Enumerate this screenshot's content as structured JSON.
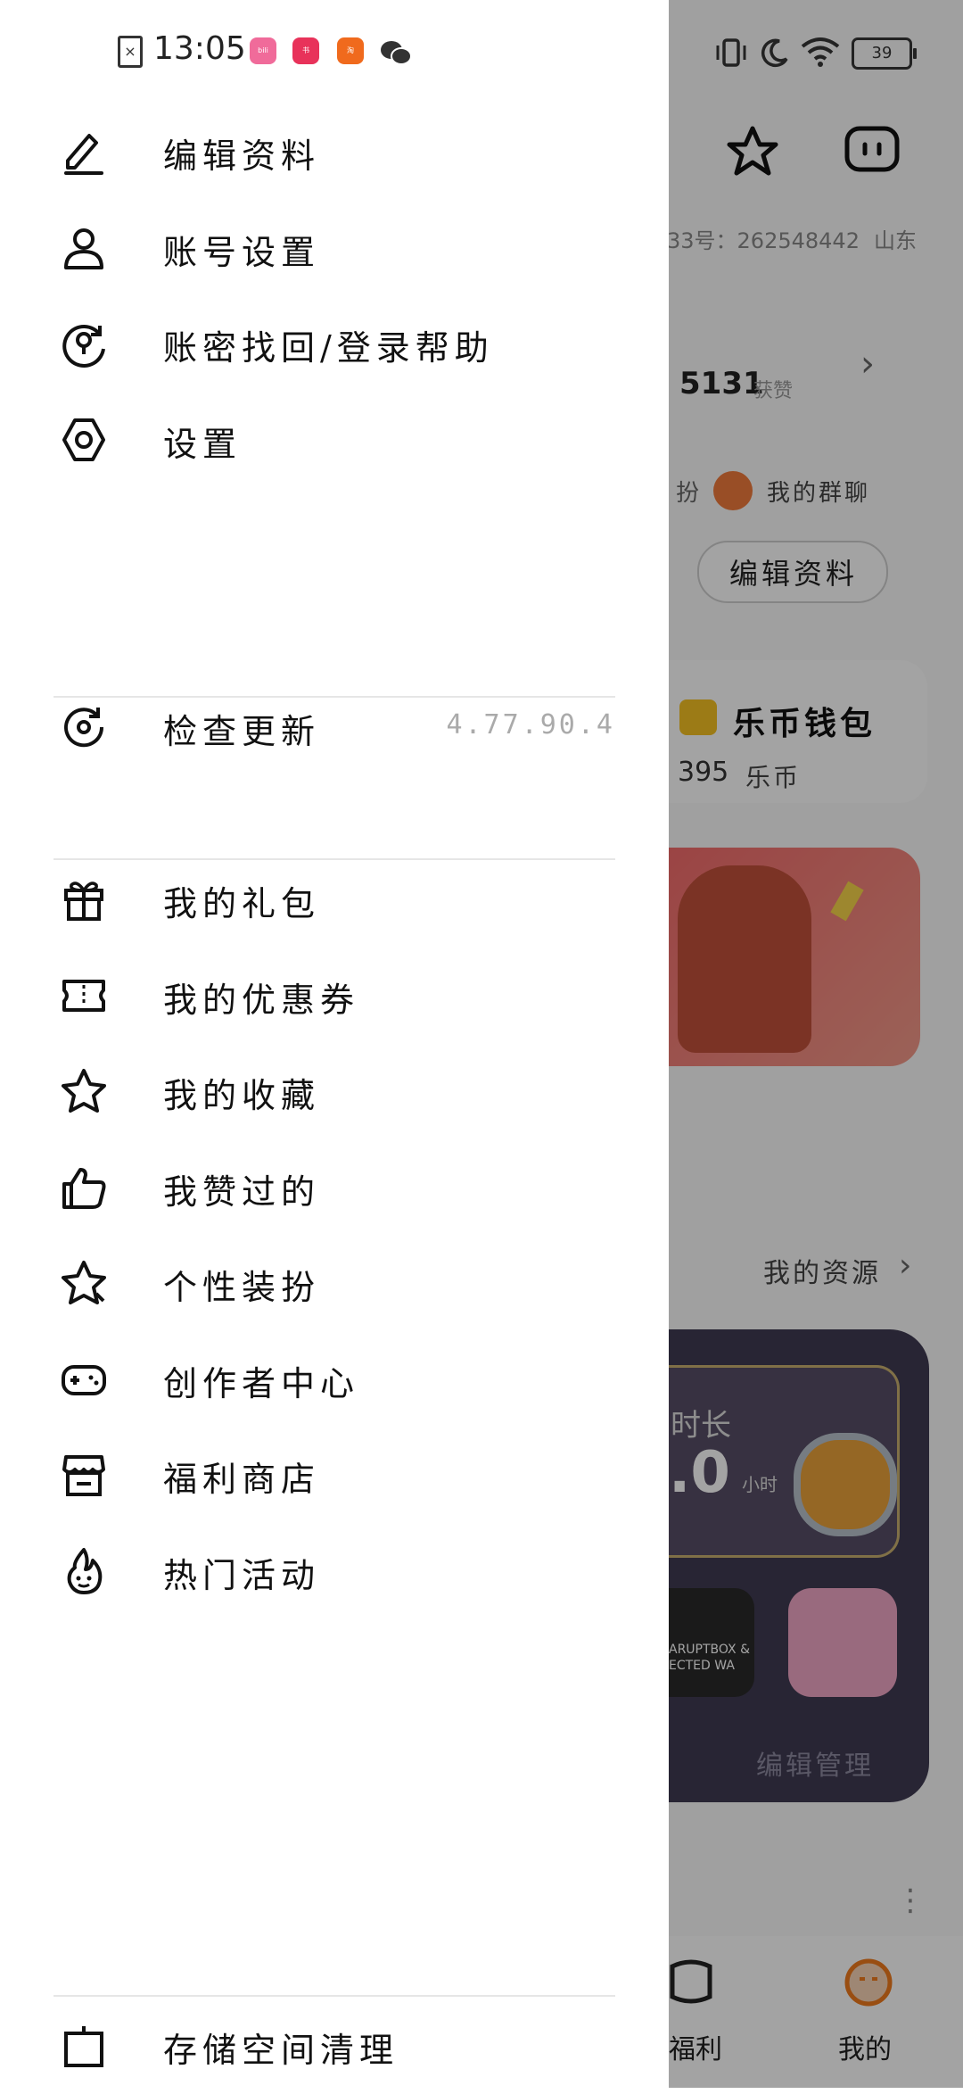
{
  "status_bar": {
    "time": "13:05",
    "battery": "39",
    "app_icons": [
      {
        "name": "bilibili-app-icon",
        "color": "#f06b9a"
      },
      {
        "name": "xiaohongshu-app-icon",
        "color": "#e8325a"
      },
      {
        "name": "taobao-app-icon",
        "color": "#f06a1d"
      },
      {
        "name": "wechat-app-icon",
        "color": "#333333"
      }
    ]
  },
  "drawer": {
    "items": [
      {
        "label": "编辑资料",
        "icon": "edit-icon"
      },
      {
        "label": "账号设置",
        "icon": "user-icon"
      },
      {
        "label": "账密找回/登录帮助",
        "icon": "account-recovery-icon"
      },
      {
        "label": "设置",
        "icon": "settings-hexagon-icon"
      },
      {
        "label": "检查更新",
        "icon": "update-check-icon",
        "meta": "4.77.90.4"
      },
      {
        "label": "我的礼包",
        "icon": "gift-icon"
      },
      {
        "label": "我的优惠券",
        "icon": "coupon-icon"
      },
      {
        "label": "我的收藏",
        "icon": "star-icon"
      },
      {
        "label": "我赞过的",
        "icon": "thumbs-up-icon"
      },
      {
        "label": "个性装扮",
        "icon": "sparkle-star-icon"
      },
      {
        "label": "创作者中心",
        "icon": "gamepad-icon"
      },
      {
        "label": "福利商店",
        "icon": "store-icon"
      },
      {
        "label": "热门活动",
        "icon": "hot-activity-icon"
      },
      {
        "label": "存储空间清理",
        "icon": "storage-clean-icon"
      }
    ]
  },
  "background_page": {
    "id_text": "33号：262548442",
    "location": "山东",
    "likes_value": "5131",
    "likes_label": "获赞",
    "fans_label": "扮",
    "group_chat": "我的群聊",
    "edit_profile_button": "编辑资料",
    "wallet_title": "乐币钱包",
    "wallet_value": "395",
    "wallet_unit": "乐币",
    "my_resources": "我的资源",
    "duration_label": "时长",
    "duration_value": ".0",
    "duration_unit": "小时",
    "game_label": "ARUPTBOX & ECTED WA",
    "manage_button": "编辑管理",
    "tab_welfare": "福利",
    "tab_mine": "我的"
  }
}
